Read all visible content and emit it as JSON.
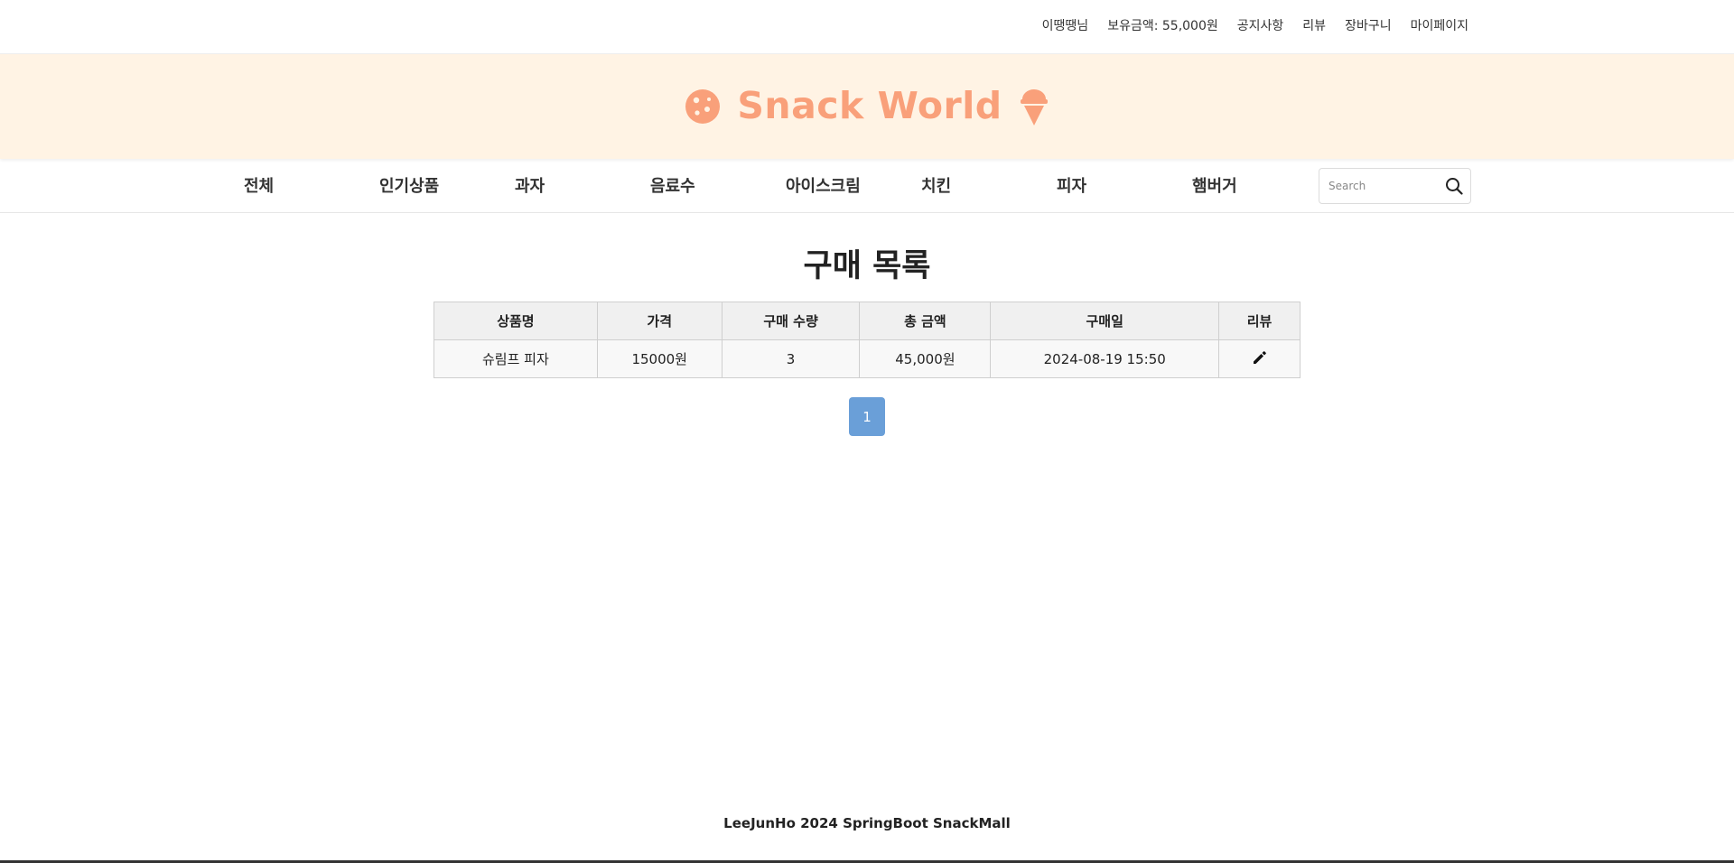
{
  "topbar": {
    "user_greeting": "이땡땡님",
    "balance": "보유금액: 55,000원",
    "notice": "공지사항",
    "review": "리뷰",
    "cart": "장바구니",
    "mypage": "마이페이지"
  },
  "brand": {
    "title": "Snack World",
    "color": "#f9a07a",
    "background": "#fff3e4",
    "left_icon": "cookie-icon",
    "right_icon": "ice-cream-icon"
  },
  "nav": {
    "items": [
      "전체",
      "인기상품",
      "과자",
      "음료수",
      "아이스크림",
      "치킨",
      "피자",
      "햄버거"
    ],
    "search_placeholder": "Search",
    "search_icon": "search-icon"
  },
  "page_title": "구매 목록",
  "orders_table": {
    "headers": [
      "상품명",
      "가격",
      "구매 수량",
      "총 금액",
      "구매일",
      "리뷰"
    ],
    "rows": [
      {
        "product": "슈림프 피자",
        "price": "15000원",
        "quantity": "3",
        "total": "45,000원",
        "date": "2024-08-19 15:50",
        "review_icon": "pencil-icon"
      }
    ]
  },
  "pagination": {
    "current": "1",
    "active_color": "#6a9fd8"
  },
  "footer": "LeeJunHo 2024 SpringBoot SnackMall"
}
